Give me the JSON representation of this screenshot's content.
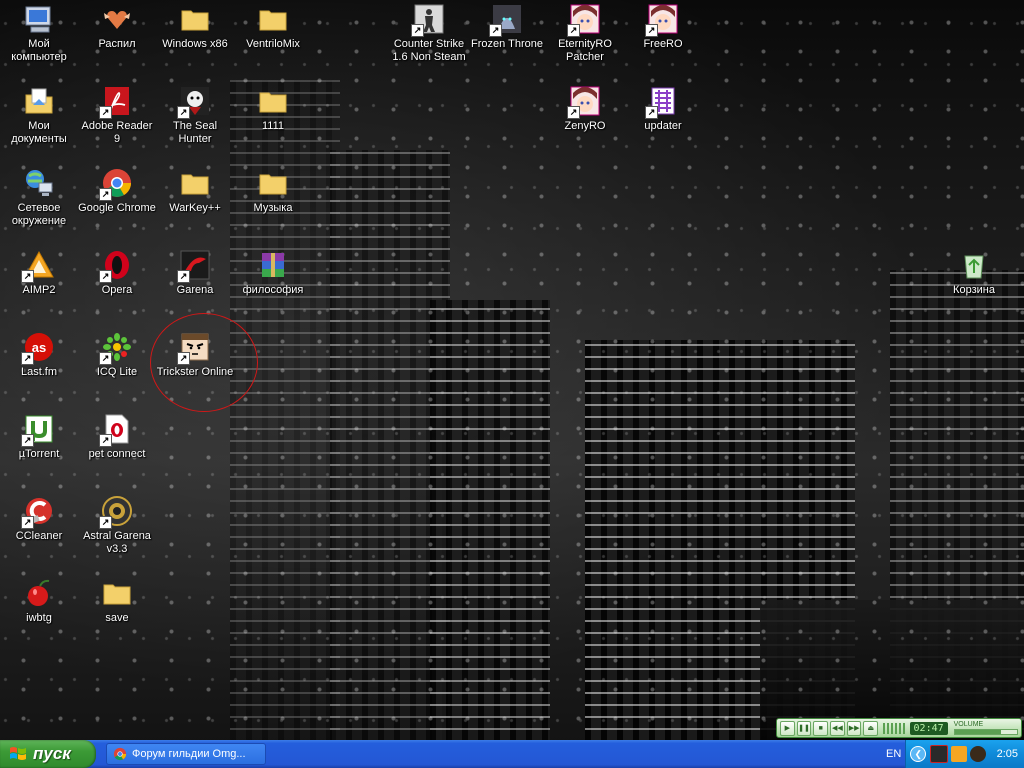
{
  "desktop_icons": [
    {
      "label": "Мой компьютер",
      "icon": "my-computer-icon"
    },
    {
      "label": "Распил",
      "icon": "heart-wings-icon"
    },
    {
      "label": "Windows x86",
      "icon": "folder-icon"
    },
    {
      "label": "VentriloMix",
      "icon": "folder-icon"
    },
    {
      "label": "Counter Strike 1.6 Non Steam",
      "icon": "counter-strike-icon"
    },
    {
      "label": "Frozen Throne",
      "icon": "frozen-throne-icon"
    },
    {
      "label": "EternityRO Patcher",
      "icon": "anime-face-icon"
    },
    {
      "label": "FreeRO",
      "icon": "anime-face-icon"
    },
    {
      "label": "Мои документы",
      "icon": "my-documents-icon"
    },
    {
      "label": "Adobe Reader 9",
      "icon": "adobe-reader-icon"
    },
    {
      "label": "The Seal Hunter",
      "icon": "seal-hunter-icon"
    },
    {
      "label": "1111",
      "icon": "folder-icon"
    },
    {
      "label": "ZenyRO",
      "icon": "anime-face-icon"
    },
    {
      "label": "updater",
      "icon": "updater-icon"
    },
    {
      "label": "Сетевое окружение",
      "icon": "network-icon"
    },
    {
      "label": "Google Chrome",
      "icon": "chrome-icon"
    },
    {
      "label": "WarKey++",
      "icon": "folder-icon"
    },
    {
      "label": "Музыка",
      "icon": "folder-icon"
    },
    {
      "label": "AIMP2",
      "icon": "aimp-icon"
    },
    {
      "label": "Opera",
      "icon": "opera-icon"
    },
    {
      "label": "Garena",
      "icon": "garena-icon"
    },
    {
      "label": "философия",
      "icon": "winrar-icon"
    },
    {
      "label": "Корзина",
      "icon": "recycle-bin-icon"
    },
    {
      "label": "Last.fm",
      "icon": "lastfm-icon"
    },
    {
      "label": "ICQ Lite",
      "icon": "icq-icon"
    },
    {
      "label": "Trickster Online",
      "icon": "trickster-face-icon"
    },
    {
      "label": "µTorrent",
      "icon": "utorrent-icon"
    },
    {
      "label": "pet connect",
      "icon": "opera-document-icon"
    },
    {
      "label": "CCleaner",
      "icon": "ccleaner-icon"
    },
    {
      "label": "Astral Garena v3.3",
      "icon": "astral-garena-icon"
    },
    {
      "label": "iwbtg",
      "icon": "iwbtg-cherry-icon"
    },
    {
      "label": "save",
      "icon": "folder-icon"
    }
  ],
  "aimp": {
    "controls": [
      "play",
      "pause",
      "stop",
      "previous",
      "next",
      "eject"
    ],
    "time": "02:47",
    "volume_label": "VOLUME",
    "volume_level": 0.75
  },
  "taskbar": {
    "start_label": "пуск",
    "task_label": "Форум гильдии Omg...",
    "language": "EN",
    "clock": "2:05"
  },
  "colors": {
    "taskbar_blue": "#245edc",
    "start_green": "#3c9a36",
    "tray_blue": "#0f8ad9",
    "circle_red": "#d01818"
  }
}
